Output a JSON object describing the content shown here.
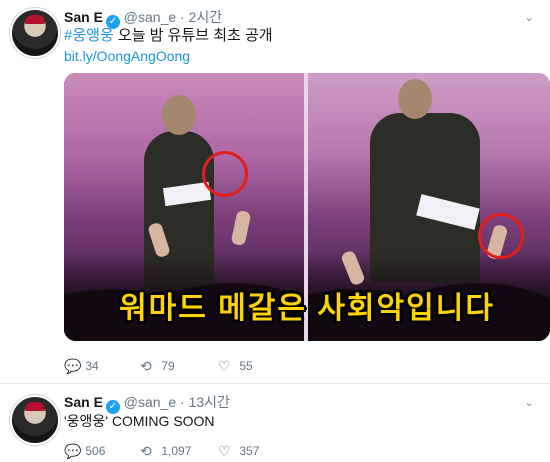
{
  "tweets": [
    {
      "name": "San E",
      "handle": "@san_e",
      "separator": "·",
      "time": "2시간",
      "hashtag": "#웅앵웅",
      "text": " 오늘 밤 유튜브 최초 공개",
      "link": "bit.ly/OongAngOong",
      "media_caption": "워마드 메갈은 사회악입니다",
      "reply_count": "34",
      "retweet_count": "79",
      "like_count": "55"
    },
    {
      "name": "San E",
      "handle": "@san_e",
      "separator": "·",
      "time": "13시간",
      "text": "'웅앵웅' COMING SOON",
      "reply_count": "506",
      "retweet_count": "1,097",
      "like_count": "357"
    }
  ],
  "icons": {
    "verified": "✓",
    "caret": "⌄",
    "reply": "💬",
    "retweet": "⟲",
    "like": "♡"
  },
  "colors": {
    "link": "#1b95e0",
    "verified": "#1da1f2",
    "muted": "#657786",
    "caption": "#ffd400",
    "highlight_circle": "#e31c1c"
  }
}
